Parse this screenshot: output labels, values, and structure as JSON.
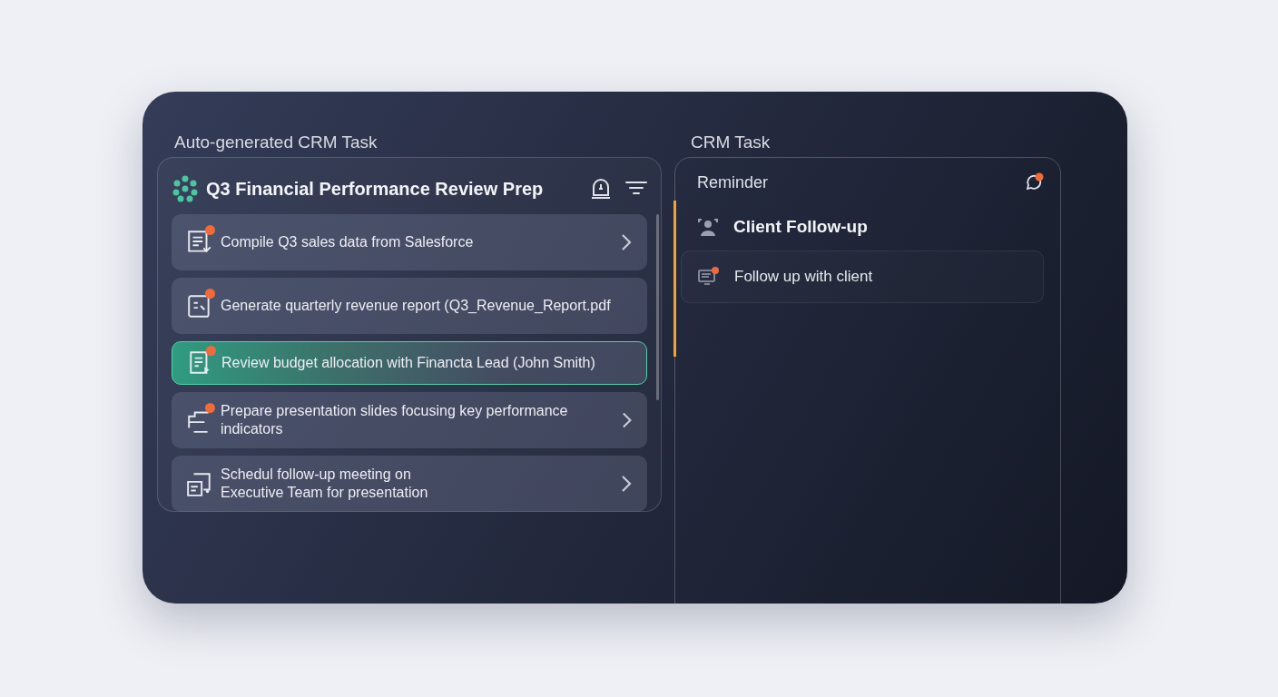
{
  "left": {
    "heading": "Auto-generated CRM Task",
    "title": "Q3 Financial Performance Review Prep",
    "items": [
      {
        "text": "Compile Q3 sales data from Salesforce",
        "dot": true,
        "chevron": true,
        "selected": false
      },
      {
        "text": "Generate quarterly revenue report (Q3_Revenue_Report.pdf",
        "dot": true,
        "chevron": false,
        "selected": false
      },
      {
        "text": "Review budget allocation with Financta Lead (John Smith)",
        "dot": true,
        "chevron": false,
        "selected": true
      },
      {
        "text": "Prepare presentation slides focusing key performance indicators",
        "dot": true,
        "chevron": true,
        "selected": false
      },
      {
        "text": "Schedul follow-up meeting on\nExecutive Team for presentation",
        "dot": false,
        "chevron": true,
        "selected": false
      }
    ]
  },
  "right": {
    "heading": "CRM Task",
    "label": "Reminder",
    "title": "Client Follow-up",
    "task": "Follow up with client"
  }
}
